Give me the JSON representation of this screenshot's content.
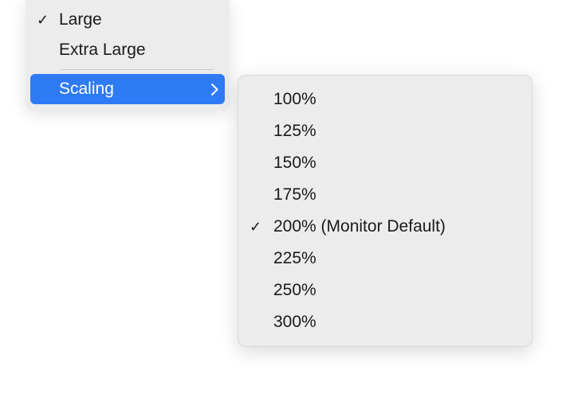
{
  "menu": {
    "items": [
      {
        "label": "Large",
        "checked": true
      },
      {
        "label": "Extra Large",
        "checked": false
      }
    ],
    "scaling_label": "Scaling"
  },
  "submenu": {
    "items": [
      {
        "label": "100%",
        "checked": false
      },
      {
        "label": "125%",
        "checked": false
      },
      {
        "label": "150%",
        "checked": false
      },
      {
        "label": "175%",
        "checked": false
      },
      {
        "label": "200% (Monitor Default)",
        "checked": true
      },
      {
        "label": "225%",
        "checked": false
      },
      {
        "label": "250%",
        "checked": false
      },
      {
        "label": "300%",
        "checked": false
      }
    ]
  },
  "glyphs": {
    "check": "✓"
  },
  "colors": {
    "highlight": "#2f7bf6",
    "menu_bg": "#ececec"
  }
}
